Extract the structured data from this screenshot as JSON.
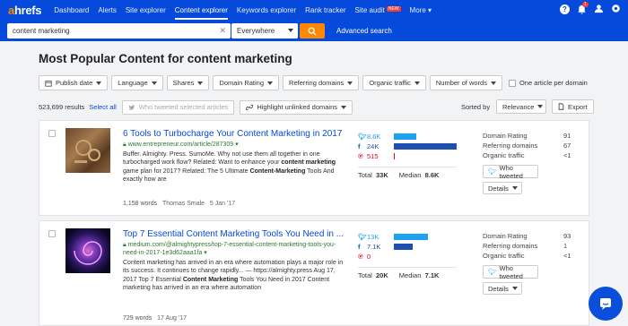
{
  "nav": {
    "logo_a": "a",
    "logo_rest": "hrefs",
    "items": [
      "Dashboard",
      "Alerts",
      "Site explorer",
      "Content explorer",
      "Keywords explorer",
      "Rank tracker",
      "Site audit",
      "More"
    ],
    "site_audit_badge": "NEW",
    "active": "Content explorer",
    "help_icon": "?",
    "notif_count": "1"
  },
  "search": {
    "value": "content marketing",
    "mode": "Everywhere",
    "advanced": "Advanced search"
  },
  "page_title": "Most Popular Content for content marketing",
  "filters": [
    "Publish date",
    "Language",
    "Shares",
    "Domain Rating",
    "Referring domains",
    "Organic traffic",
    "Number of words"
  ],
  "one_article": "One article per domain",
  "results": {
    "count": "523,699 results",
    "select_all": "Select all",
    "who_tweeted_selected": "Who tweeted selected articles",
    "highlight": "Highlight unlinked domains",
    "sorted_by": "Sorted by",
    "sort_value": "Relevance",
    "export": "Export"
  },
  "labels": {
    "total": "Total",
    "median": "Median",
    "domain_rating": "Domain Rating",
    "referring_domains": "Referring domains",
    "organic_traffic": "Organic traffic",
    "who_tweeted": "Who tweeted",
    "details": "Details"
  },
  "articles": [
    {
      "title": "6 Tools to Turbocharge Your Content Marketing in 2017",
      "url": "www.entrepreneur.com/article/287309",
      "desc": "Buffer. Almighty. Press. SumoMe. Why not use them all together in one turbocharged work flow? Related: Want to enhance your content marketing game plan for 2017? Related:  The 5 Ultimate Content-Marketing Tools And exactly how are",
      "words": "1,158 words",
      "author": "Thomas Smale",
      "date": "5 Jan '17",
      "twitter": "8.6K",
      "facebook": "24K",
      "pinterest": "515",
      "twitter_frac": 0.36,
      "facebook_frac": 1.0,
      "pinterest_frac": 0.02,
      "total": "33K",
      "median": "8.6K",
      "dr": "91",
      "rd": "67",
      "ot": "<1"
    },
    {
      "title": "Top 7 Essential Content Marketing Tools You Need in ...",
      "url": "medium.com/@almightypress/top-7-essential-content-marketing-tools-you-need-in-2017-1e3d62aaa1fa",
      "desc": "Content marketing has arrived in an era where automation plays a major role in its success. It continues to change rapidly... — https:&#x2F;&#x2F;almighty.press Aug 17, 2017 Top 7 Essential Content Marketing Tools You Need in 2017 Content marketing has arrived in an era where automation",
      "words": "729 words",
      "author": "",
      "date": "17 Aug '17",
      "twitter": "13K",
      "facebook": "7.1K",
      "pinterest": "0",
      "twitter_frac": 0.54,
      "facebook_frac": 0.3,
      "pinterest_frac": 0.0,
      "total": "20K",
      "median": "7.1K",
      "dr": "93",
      "rd": "1",
      "ot": "<1"
    }
  ],
  "colors": {
    "nav_bg": "#054ada",
    "accent": "#ff8800",
    "link": "#054ada",
    "url_green": "#2c7a2c",
    "twitter_bar": "#1da1f2",
    "facebook_bar": "#1f4fb0"
  }
}
